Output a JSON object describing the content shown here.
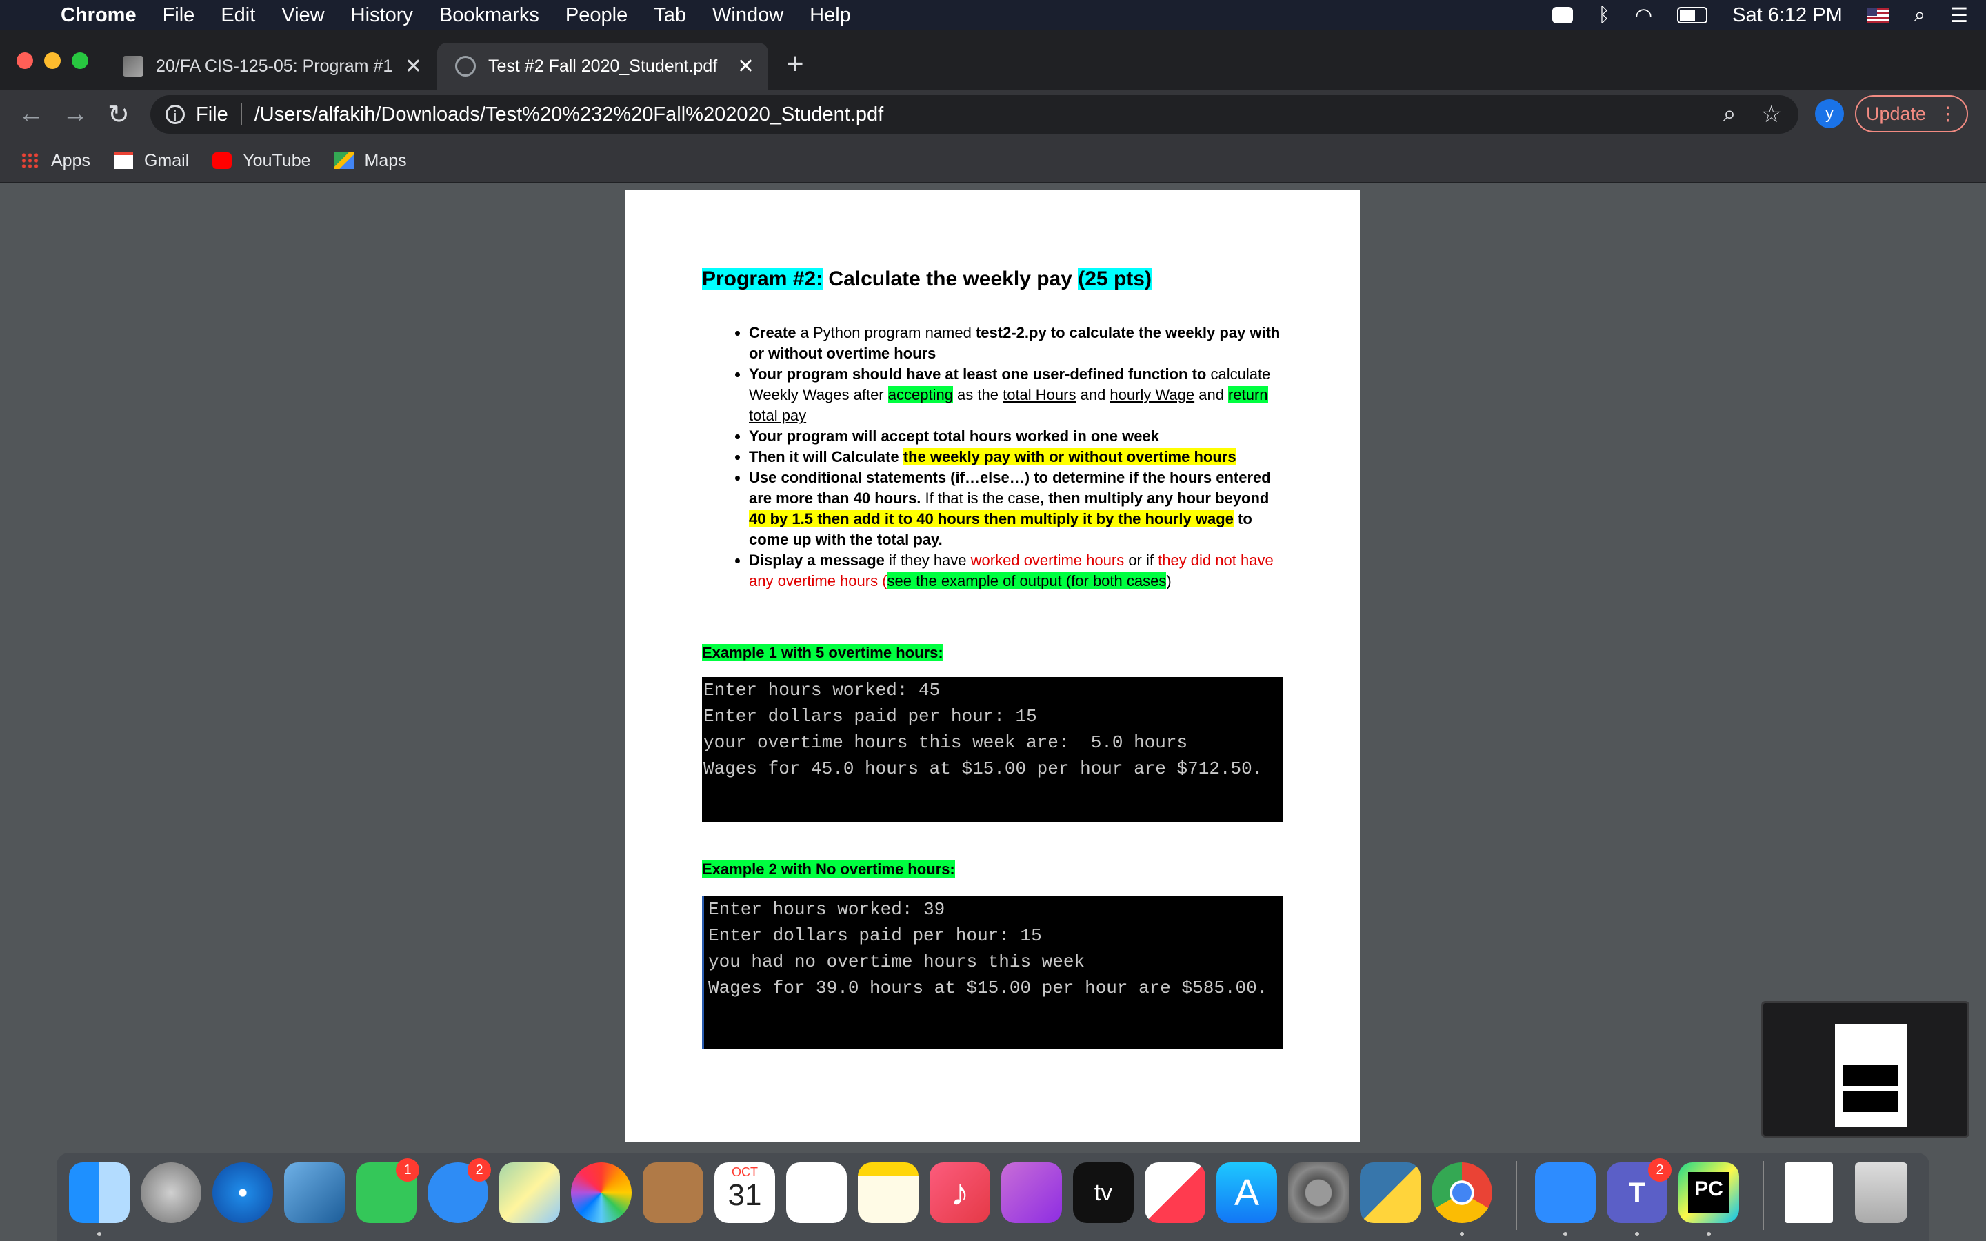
{
  "menubar": {
    "app_name": "Chrome",
    "menus": [
      "File",
      "Edit",
      "View",
      "History",
      "Bookmarks",
      "People",
      "Tab",
      "Window",
      "Help"
    ],
    "clock": "Sat 6:12 PM"
  },
  "tabs": [
    {
      "title": "20/FA CIS-125-05: Program #1",
      "active": false
    },
    {
      "title": "Test #2 Fall 2020_Student.pdf",
      "active": true
    }
  ],
  "omnibox": {
    "scheme_label": "File",
    "url": "/Users/alfakih/Downloads/Test%20%232%20Fall%202020_Student.pdf"
  },
  "profile_initial": "y",
  "update_label": "Update",
  "bookmarks": [
    "Apps",
    "Gmail",
    "YouTube",
    "Maps"
  ],
  "document": {
    "title_prefix": "Program #2:",
    "title_main": " Calculate the weekly pay ",
    "title_pts": "(25 pts)",
    "bullets": {
      "b1_create": "Create",
      "b1_a": " a Python program named ",
      "b1_file": "test2-2.py to calculate the weekly pay with or without overtime hours",
      "b2_bold": "Your program should have at least one user-defined function to",
      "b2_a": " calculate Weekly Wages after ",
      "b2_accepting": "accepting",
      "b2_b": " as the ",
      "b2_total_hours": "total Hours",
      "b2_c": " and ",
      "b2_hourly_wage": "hourly Wage",
      "b2_d": " and ",
      "b2_return": "return",
      "b2_e": " ",
      "b2_total_pay": "total pay",
      "b3": "Your program will accept total hours worked in one week",
      "b4_a": "Then it will Calculate ",
      "b4_hl": "the weekly pay with or without overtime hours",
      "b5_a": "Use conditional statements (if…else…) to determine if the hours entered are more than 40 hours.",
      "b5_b": " If that is the case",
      "b5_c": ", then multiply any hour beyond ",
      "b5_hl": "40 by 1.5 then add it to 40 hours then multiply it by the hourly wage",
      "b5_d": " to come up with the total pay.",
      "b6_a": "Display a message",
      "b6_b": " if they have ",
      "b6_red1": "worked overtime hours",
      "b6_c": " or if ",
      "b6_red2": "they did not have any overtime hours",
      "b6_d": " (",
      "b6_hl": "see the example of output (for both cases",
      "b6_e": ")"
    },
    "example1_label": "Example 1 with 5 overtime hours:",
    "example1_lines": [
      "Enter hours worked: 45",
      "Enter dollars paid per hour: 15",
      "your overtime hours this week are:  5.0 hours",
      "Wages for 45.0 hours at $15.00 per hour are $712.50."
    ],
    "example2_label": "Example 2 with No overtime hours:",
    "example2_lines": [
      "Enter hours worked: 39",
      "Enter dollars paid per hour: 15",
      "you had no overtime hours this week",
      "Wages for 39.0 hours at $15.00 per hour are $585.00."
    ]
  },
  "dock": {
    "calendar_month": "OCT",
    "calendar_day": "31",
    "facetime_badge": "1",
    "messages_badge": "2",
    "teams_badge": "2",
    "appletv_label": "tv",
    "pycharm_label": "PC"
  },
  "colors": {
    "highlight_cyan": "#00ffff",
    "highlight_green": "#00ff40",
    "highlight_yellow": "#ffff00",
    "text_red": "#e00000",
    "update_accent": "#f28b82"
  }
}
